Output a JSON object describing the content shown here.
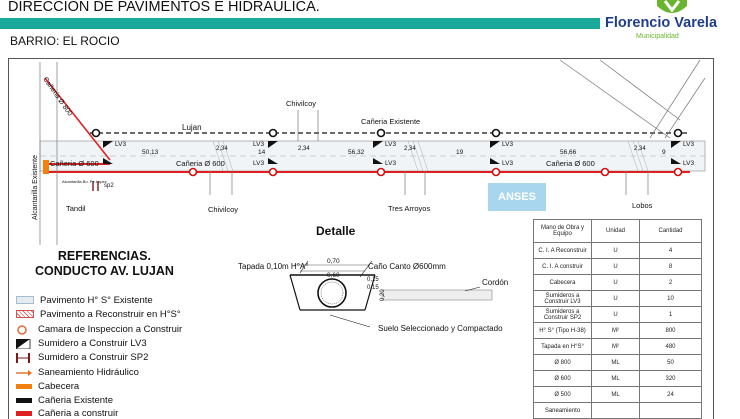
{
  "header": {
    "title": "DIRECCIÓN DE PAVIMENTOS E HIDRÁULICA.",
    "barrio": "BARRIO: EL ROCIO",
    "logo_name": "Florencio Varela",
    "logo_sub": "Municipalidad",
    "accent_color": "#1aa89a"
  },
  "plan": {
    "streets": {
      "lujan": "Lujan",
      "chivilcoy_top": "Chivilcoy",
      "chivilcoy_bottom": "Chivilcoy",
      "tres_arroyos": "Tres Arroyos",
      "lobos": "Lobos",
      "tandil": "Tandil",
      "alcantarilla": "Alcantarilla Existente"
    },
    "labels": {
      "caneria_existente": "Cañeria Existente",
      "caneria_800": "Cañeria Ø 800",
      "caneria_600_left": "Cañeria Ø 600",
      "caneria_600_mid": "Cañeria Ø 600",
      "caneria_600_right": "Cañeria Ø 600",
      "lv3": "LV3",
      "sp2": "sp2",
      "anses": "ANSES",
      "alcantarilla_small": "Alcantarilla Bo. Pe.Lopez"
    },
    "dimensions": [
      "50,13",
      "14",
      "56,32",
      "19",
      "56,66",
      "9"
    ],
    "small_dims": [
      "2,34",
      "2,34",
      "2,34",
      "2,34"
    ],
    "manholes": [
      "CI",
      "CI",
      "CI",
      "CI",
      "CI"
    ]
  },
  "references": {
    "title_line1": "REFERENCIAS.",
    "title_line2": "CONDUCTO AV. LUJAN",
    "items": [
      {
        "label": "Pavimento H° S° Existente",
        "icon": "pavement-existing-icon"
      },
      {
        "label": "Pavimento a Reconstruir  en H°S°",
        "icon": "pavement-rebuild-icon"
      },
      {
        "label": "Camara de Inspeccion a Construir",
        "icon": "inspection-chamber-icon"
      },
      {
        "label": "Sumidero a Construir LV3",
        "icon": "sink-lv3-icon"
      },
      {
        "label": "Sumidero a Construir SP2",
        "icon": "sink-sp2-icon"
      },
      {
        "label": "Saneamiento Hidráulico",
        "icon": "hydraulic-arrow-icon"
      },
      {
        "label": "Cabecera",
        "icon": "header-wall-icon"
      },
      {
        "label": "Cañeria Existente",
        "icon": "existing-pipe-icon"
      },
      {
        "label": "Cañeria a construir",
        "icon": "new-pipe-icon"
      }
    ]
  },
  "detail": {
    "title": "Detalle",
    "tapada": "Tapada 0,10m H°A°",
    "canio": "Caño Canto Ø600mm",
    "cordon": "Cordón",
    "suelo": "Suelo Seleccionado y Compactado",
    "dims": [
      "0,70",
      "0,60",
      "0,15",
      "0,15",
      "0,20"
    ]
  },
  "quantities": {
    "headers": [
      "Mano de Obra y Equipo",
      "Unidad",
      "Cantidad"
    ],
    "rows": [
      [
        "C. I. A Reconstruir",
        "U",
        "4"
      ],
      [
        "C. I. A construir",
        "U",
        "8"
      ],
      [
        "Cabecera",
        "U",
        "2"
      ],
      [
        "Sumideros a Construir LV3",
        "U",
        "10"
      ],
      [
        "Sumideros a Construir SP2",
        "U",
        "1"
      ],
      [
        "H° S° (Tipo H-38)",
        "M²",
        "800"
      ],
      [
        "Tapada  en H°S°",
        "M²",
        "480"
      ],
      [
        "Ø 800",
        "ML",
        "50"
      ],
      [
        "Ø 600",
        "ML",
        "320"
      ],
      [
        "Ø 500",
        "ML",
        "24"
      ],
      [
        "Saneamiento",
        "",
        ""
      ]
    ]
  }
}
